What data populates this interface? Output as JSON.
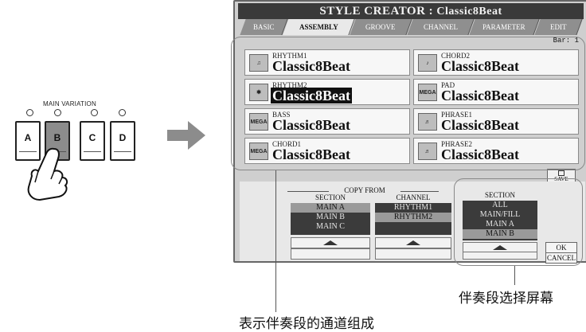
{
  "left_panel": {
    "label": "MAIN VARIATION",
    "buttons": [
      "A",
      "B",
      "C",
      "D"
    ]
  },
  "screen": {
    "title_prefix": "STYLE CREATOR : ",
    "title_value": "Classic8Beat",
    "tabs": [
      "BASIC",
      "ASSEMBLY",
      "GROOVE",
      "CHANNEL",
      "PARAMETER",
      "EDIT"
    ],
    "active_tab": "ASSEMBLY",
    "bar_label": "Bar:",
    "bar_value": "1",
    "channels": [
      {
        "channel": "RHYTHM1",
        "style": "Classic8Beat",
        "icon": "drum-kit-icon"
      },
      {
        "channel": "CHORD2",
        "style": "Classic8Beat",
        "icon": "guitar-icon"
      },
      {
        "channel": "RHYTHM2",
        "style": "Classic8Beat",
        "icon": "percussion-icon"
      },
      {
        "channel": "PAD",
        "style": "Classic8Beat",
        "icon": "mega-voice-icon"
      },
      {
        "channel": "BASS",
        "style": "Classic8Beat",
        "icon": "mega-voice-icon"
      },
      {
        "channel": "PHRASE1",
        "style": "Classic8Beat",
        "icon": "piano-icon"
      },
      {
        "channel": "CHORD1",
        "style": "Classic8Beat",
        "icon": "mega-voice-icon"
      },
      {
        "channel": "PHRASE2",
        "style": "Classic8Beat",
        "icon": "piano-icon"
      }
    ],
    "save_label": "SAVE",
    "copy_from": {
      "title": "COPY FROM",
      "section_header": "SECTION",
      "section_items": [
        "MAIN A",
        "MAIN B",
        "MAIN C"
      ],
      "channel_header": "CHANNEL",
      "channel_items": [
        "RHYTHM1",
        "RHYTHM2"
      ]
    },
    "section_select": {
      "header": "SECTION",
      "items": [
        "ALL",
        "MAIN/FILL",
        "MAIN A",
        "MAIN B"
      ]
    },
    "ok_label": "OK",
    "cancel_label": "CANCEL"
  },
  "captions": {
    "section_screen": "伴奏段选择屏幕",
    "channel_composition": "表示伴奏段的通道组成"
  }
}
